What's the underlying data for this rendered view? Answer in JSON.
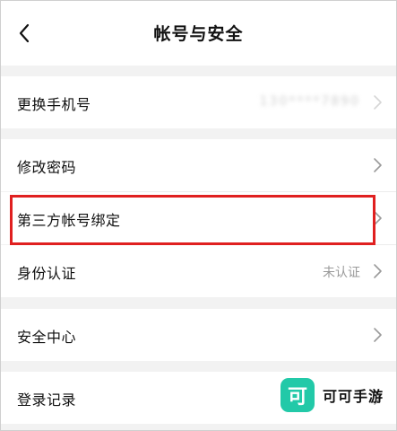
{
  "header": {
    "title": "帐号与安全"
  },
  "rows": {
    "change_phone": {
      "label": "更换手机号",
      "value": "130****7890"
    },
    "change_password": {
      "label": "修改密码"
    },
    "third_party": {
      "label": "第三方帐号绑定"
    },
    "identity": {
      "label": "身份认证",
      "value": "未认证"
    },
    "security_center": {
      "label": "安全中心"
    },
    "login_record": {
      "label": "登录记录"
    }
  },
  "watermark": {
    "logo_glyph": "可",
    "text": "可可手游",
    "logo_color": "#22c9a8"
  },
  "colors": {
    "highlight": "#e02020",
    "background": "#f2f2f2"
  }
}
